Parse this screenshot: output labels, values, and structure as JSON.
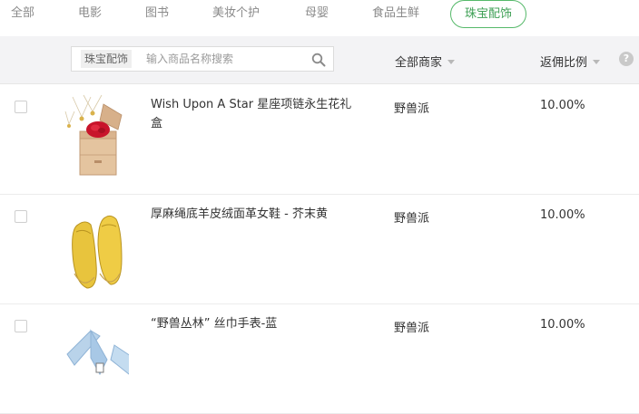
{
  "tabs": [
    {
      "label": "全部"
    },
    {
      "label": "电影"
    },
    {
      "label": "图书"
    },
    {
      "label": "美妆个护"
    },
    {
      "label": "母婴"
    },
    {
      "label": "食品生鲜"
    },
    {
      "label": "珠宝配饰",
      "active": true
    }
  ],
  "filter": {
    "search_tag": "珠宝配饰",
    "search_placeholder": "输入商品名称搜索",
    "merchant_label": "全部商家",
    "rebate_label": "返佣比例",
    "help": "?"
  },
  "products": [
    {
      "name": "Wish Upon A Star 星座项链永生花礼盒",
      "merchant": "野兽派",
      "rate": "10.00%",
      "image": "necklace-giftbox"
    },
    {
      "name": "厚麻绳底羊皮绒面革女鞋 - 芥末黄",
      "merchant": "野兽派",
      "rate": "10.00%",
      "image": "yellow-loafers"
    },
    {
      "name": "“野兽丛林” 丝巾手表-蓝",
      "merchant": "野兽派",
      "rate": "10.00%",
      "image": "silk-scarf-watch"
    }
  ],
  "colors": {
    "accent": "#56b96a",
    "header_bg": "#f3f3f5",
    "text": "#333333",
    "muted": "#8a8a8a"
  }
}
